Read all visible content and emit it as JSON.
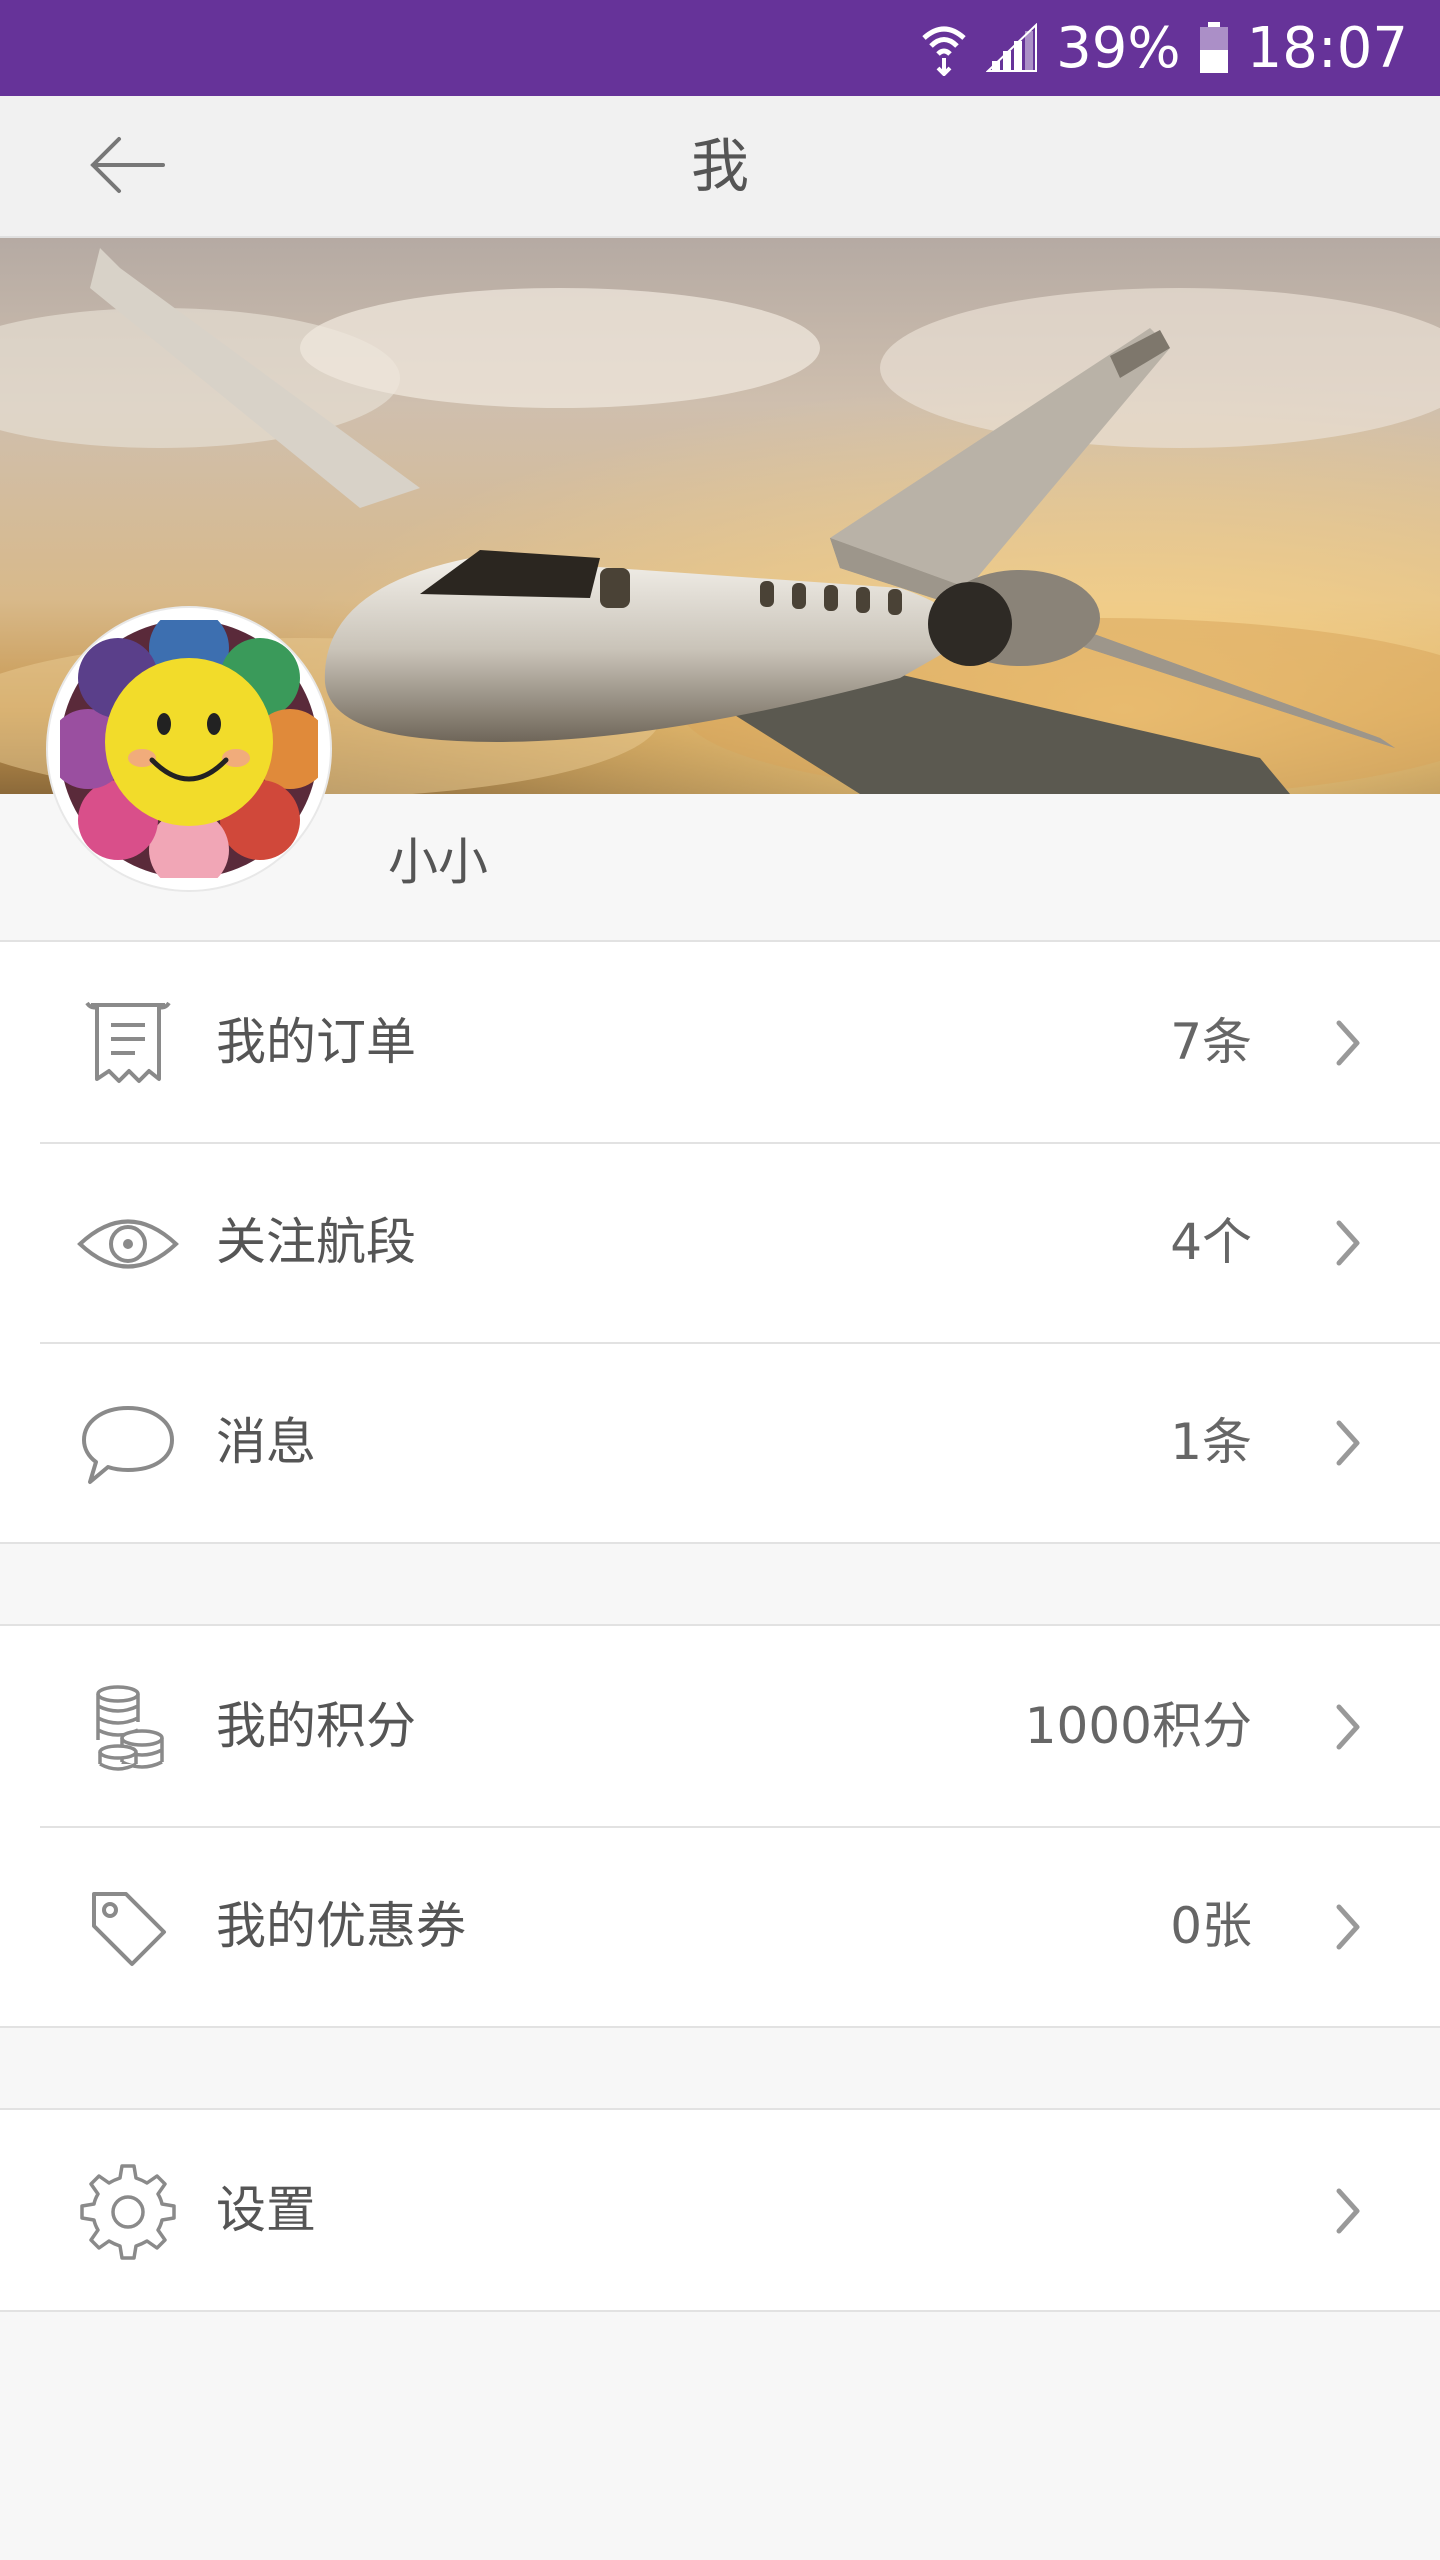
{
  "status_bar": {
    "battery": "39%",
    "time": "18:07",
    "icons": [
      "wifi-icon",
      "signal-icon",
      "battery-icon"
    ]
  },
  "header": {
    "title": "我",
    "back_icon": "back-arrow-icon"
  },
  "profile": {
    "name": "小小",
    "banner": "private-jet-banner",
    "avatar": "crochet-sunflower-avatar"
  },
  "groups": [
    {
      "items": [
        {
          "icon": "receipt-icon",
          "label": "我的订单",
          "value": "7条"
        },
        {
          "icon": "eye-icon",
          "label": "关注航段",
          "value": "4个"
        },
        {
          "icon": "chat-bubble-icon",
          "label": "消息",
          "value": "1条"
        }
      ]
    },
    {
      "items": [
        {
          "icon": "coins-icon",
          "label": "我的积分",
          "value": "1000积分"
        },
        {
          "icon": "tag-icon",
          "label": "我的优惠券",
          "value": "0张"
        }
      ]
    },
    {
      "items": [
        {
          "icon": "gear-icon",
          "label": "设置",
          "value": ""
        }
      ]
    }
  ],
  "colors": {
    "status_bar": "#663399",
    "header_bg": "#f1f1f1",
    "page_bg": "#f7f7f7",
    "text": "#555555",
    "icon": "#8a8a8a"
  }
}
